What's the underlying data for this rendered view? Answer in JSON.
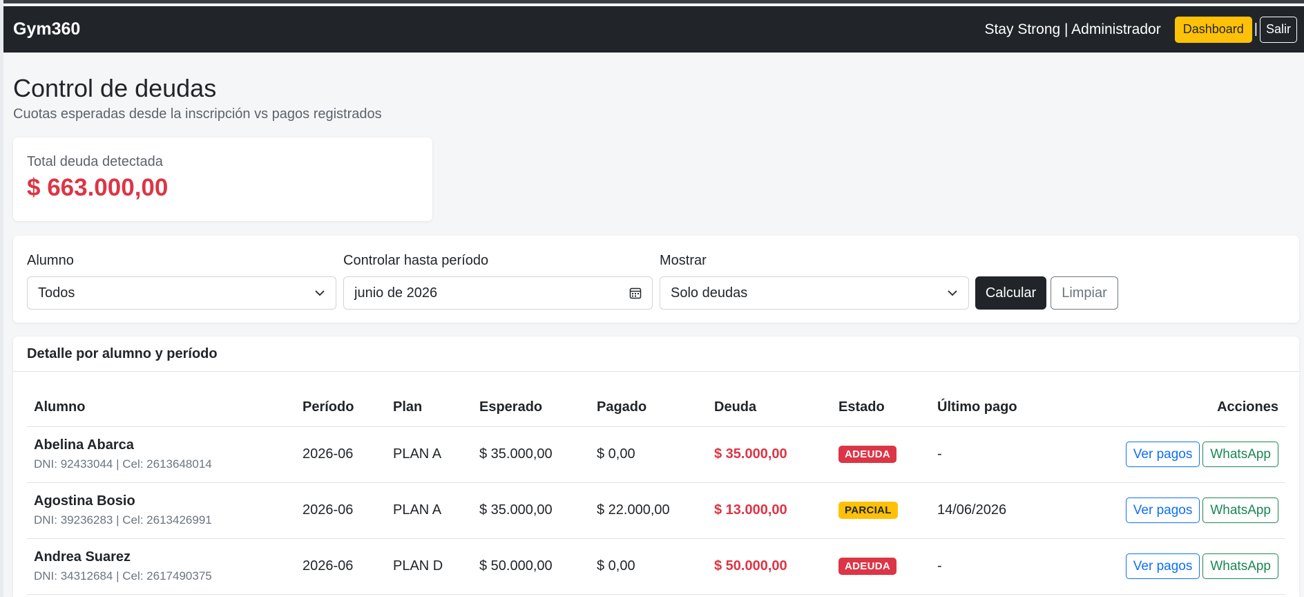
{
  "navbar": {
    "brand": "Gym360",
    "user_text": "Stay Strong | Administrador",
    "dashboard_label": "Dashboard",
    "separator": "|",
    "salir_label": "Salir"
  },
  "page": {
    "title": "Control de deudas",
    "subtitle": "Cuotas esperadas desde la inscripción vs pagos registrados"
  },
  "summary": {
    "label": "Total deuda detectada",
    "value": "$ 663.000,00"
  },
  "filters": {
    "alumno_label": "Alumno",
    "alumno_value": "Todos",
    "periodo_label": "Controlar hasta período",
    "periodo_value": "junio de 2026",
    "mostrar_label": "Mostrar",
    "mostrar_value": "Solo deudas",
    "calcular_label": "Calcular",
    "limpiar_label": "Limpiar"
  },
  "table": {
    "title": "Detalle por alumno y período",
    "headers": [
      "Alumno",
      "Período",
      "Plan",
      "Esperado",
      "Pagado",
      "Deuda",
      "Estado",
      "Último pago",
      "Acciones"
    ],
    "ver_pagos_label": "Ver pagos",
    "whatsapp_label": "WhatsApp",
    "rows": [
      {
        "name": "Abelina Abarca",
        "info": "DNI: 92433044 | Cel: 2613648014",
        "periodo": "2026-06",
        "plan": "PLAN A",
        "esperado": "$ 35.000,00",
        "pagado": "$ 0,00",
        "deuda": "$ 35.000,00",
        "estado": "ADEUDA",
        "ultimo_pago": "-"
      },
      {
        "name": "Agostina Bosio",
        "info": "DNI: 39236283 | Cel: 2613426991",
        "periodo": "2026-06",
        "plan": "PLAN A",
        "esperado": "$ 35.000,00",
        "pagado": "$ 22.000,00",
        "deuda": "$ 13.000,00",
        "estado": "PARCIAL",
        "ultimo_pago": "14/06/2026"
      },
      {
        "name": "Andrea Suarez",
        "info": "DNI: 34312684 | Cel: 2617490375",
        "periodo": "2026-06",
        "plan": "PLAN D",
        "esperado": "$ 50.000,00",
        "pagado": "$ 0,00",
        "deuda": "$ 50.000,00",
        "estado": "ADEUDA",
        "ultimo_pago": "-"
      }
    ]
  }
}
